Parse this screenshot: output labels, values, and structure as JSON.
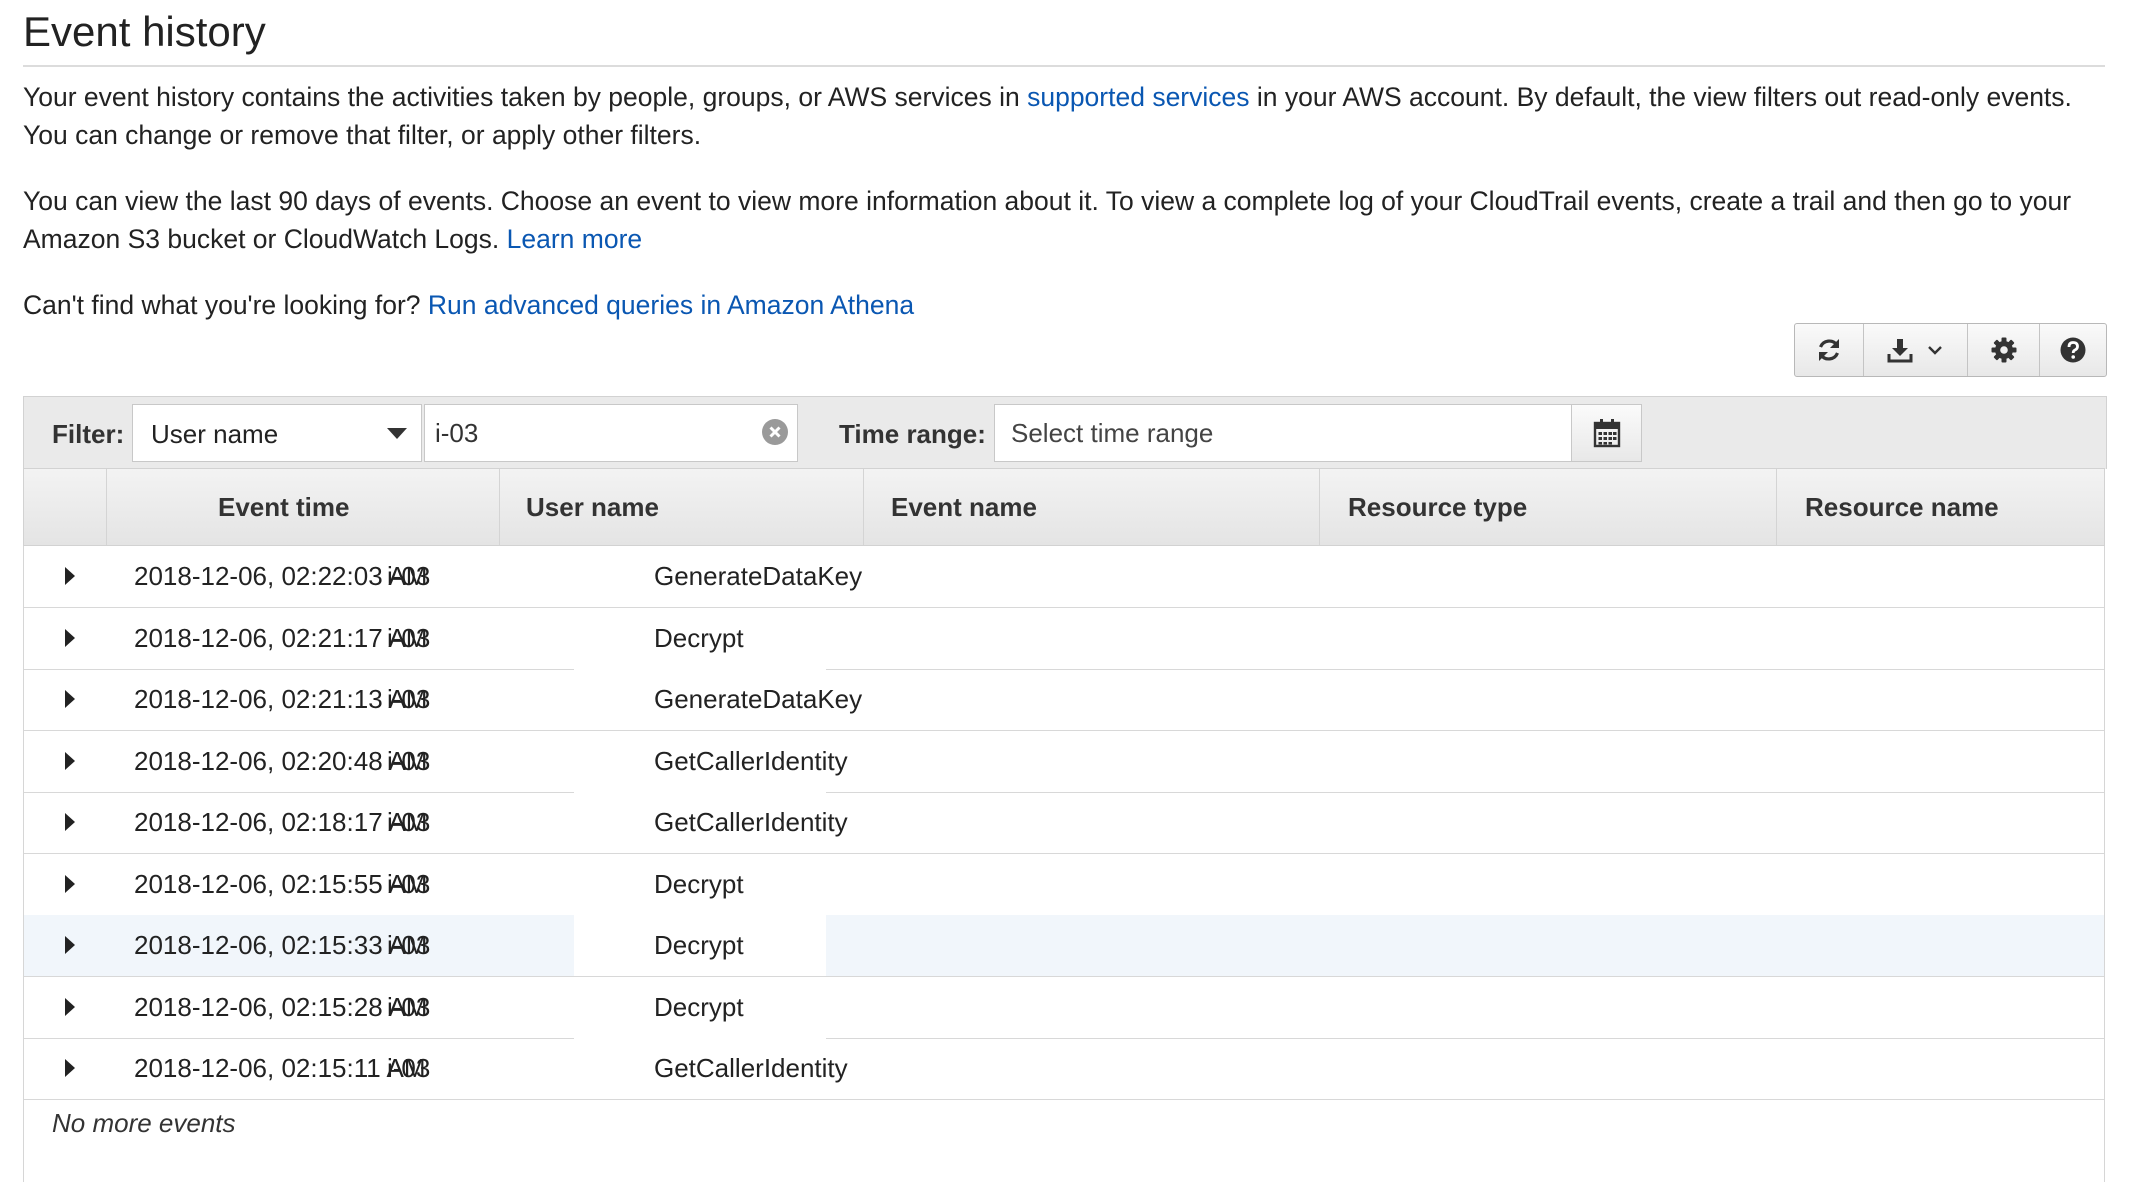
{
  "page": {
    "title": "Event history",
    "intro": {
      "text_a": "Your event history contains the activities taken by people, groups, or AWS services in ",
      "link_supported": "supported services",
      "text_b": " in your AWS account. By default, the view filters out read-only events. You can change or remove that filter, or apply other filters."
    },
    "days": {
      "text": "You can view the last 90 days of events. Choose an event to view more information about it. To view a complete log of your CloudTrail events, create a trail and then go to your Amazon S3 bucket or CloudWatch Logs. ",
      "link_learn": "Learn more"
    },
    "find": {
      "text": "Can't find what you're looking for? ",
      "link_athena": "Run advanced queries in Amazon Athena"
    }
  },
  "toolbar": {
    "icons": [
      "refresh-icon",
      "download-icon",
      "chevron-down-icon",
      "gear-icon",
      "help-icon"
    ]
  },
  "filter": {
    "label": "Filter:",
    "attribute": "User name",
    "value": "i-03",
    "time_label": "Time range:",
    "time_placeholder": "Select time range"
  },
  "table": {
    "columns": [
      "Event time",
      "User name",
      "Event name",
      "Resource type",
      "Resource name"
    ],
    "rows": [
      {
        "time": "2018-12-06, 02:22:03 AM",
        "user": "i-03",
        "event": "GenerateDataKey"
      },
      {
        "time": "2018-12-06, 02:21:17 AM",
        "user": "i-03",
        "event": "Decrypt"
      },
      {
        "time": "2018-12-06, 02:21:13 AM",
        "user": "i-03",
        "event": "GenerateDataKey"
      },
      {
        "time": "2018-12-06, 02:20:48 AM",
        "user": "i-03",
        "event": "GetCallerIdentity"
      },
      {
        "time": "2018-12-06, 02:18:17 AM",
        "user": "i-03",
        "event": "GetCallerIdentity"
      },
      {
        "time": "2018-12-06, 02:15:55 AM",
        "user": "i-03",
        "event": "Decrypt"
      },
      {
        "time": "2018-12-06, 02:15:33 AM",
        "user": "i-03",
        "event": "Decrypt"
      },
      {
        "time": "2018-12-06, 02:15:28 AM",
        "user": "i-03",
        "event": "Decrypt"
      },
      {
        "time": "2018-12-06, 02:15:11 AM",
        "user": "i-03",
        "event": "GetCallerIdentity"
      }
    ],
    "footer": "No more events"
  },
  "colors": {
    "link": "#0a57b2",
    "row_highlight": "#f1f6fb"
  }
}
